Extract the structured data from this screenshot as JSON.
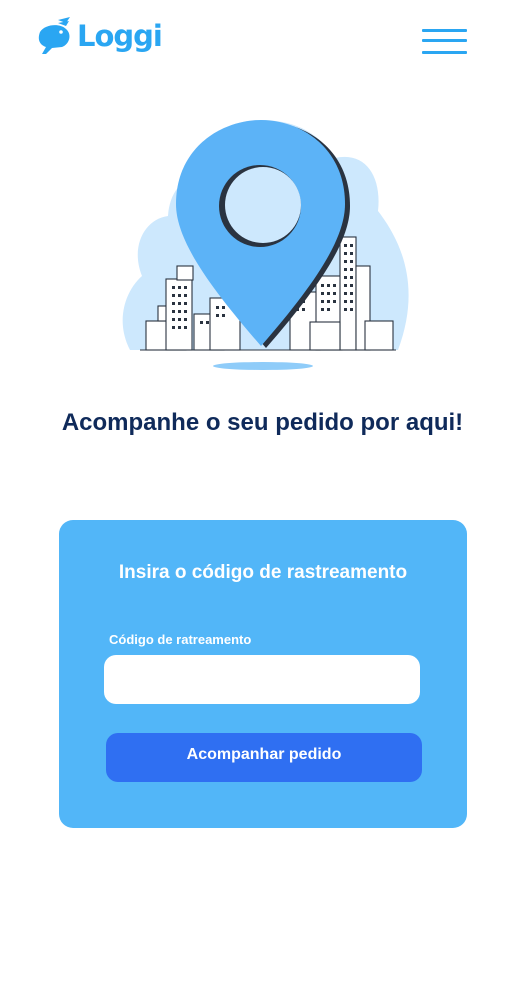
{
  "header": {
    "logo_text": "Loggi",
    "logo_icon": "rabbit-logo-icon",
    "menu_icon": "hamburger-menu-icon"
  },
  "illustration": {
    "icon": "map-pin-city-illustration"
  },
  "main": {
    "headline": "Acompanhe o seu pedido por aqui!"
  },
  "card": {
    "title": "Insira o código de rastreamento",
    "field_label": "Código de ratreamento",
    "input_value": "",
    "input_placeholder": "",
    "button_label": "Acompanhar pedido"
  },
  "colors": {
    "brand": "#2aa6f2",
    "card_background": "#52b6f8",
    "button_background": "#2f6ff2",
    "headline": "#0f2a5a",
    "illustration_pin": "#5cb3f7",
    "illustration_blob": "#cde8fd"
  }
}
